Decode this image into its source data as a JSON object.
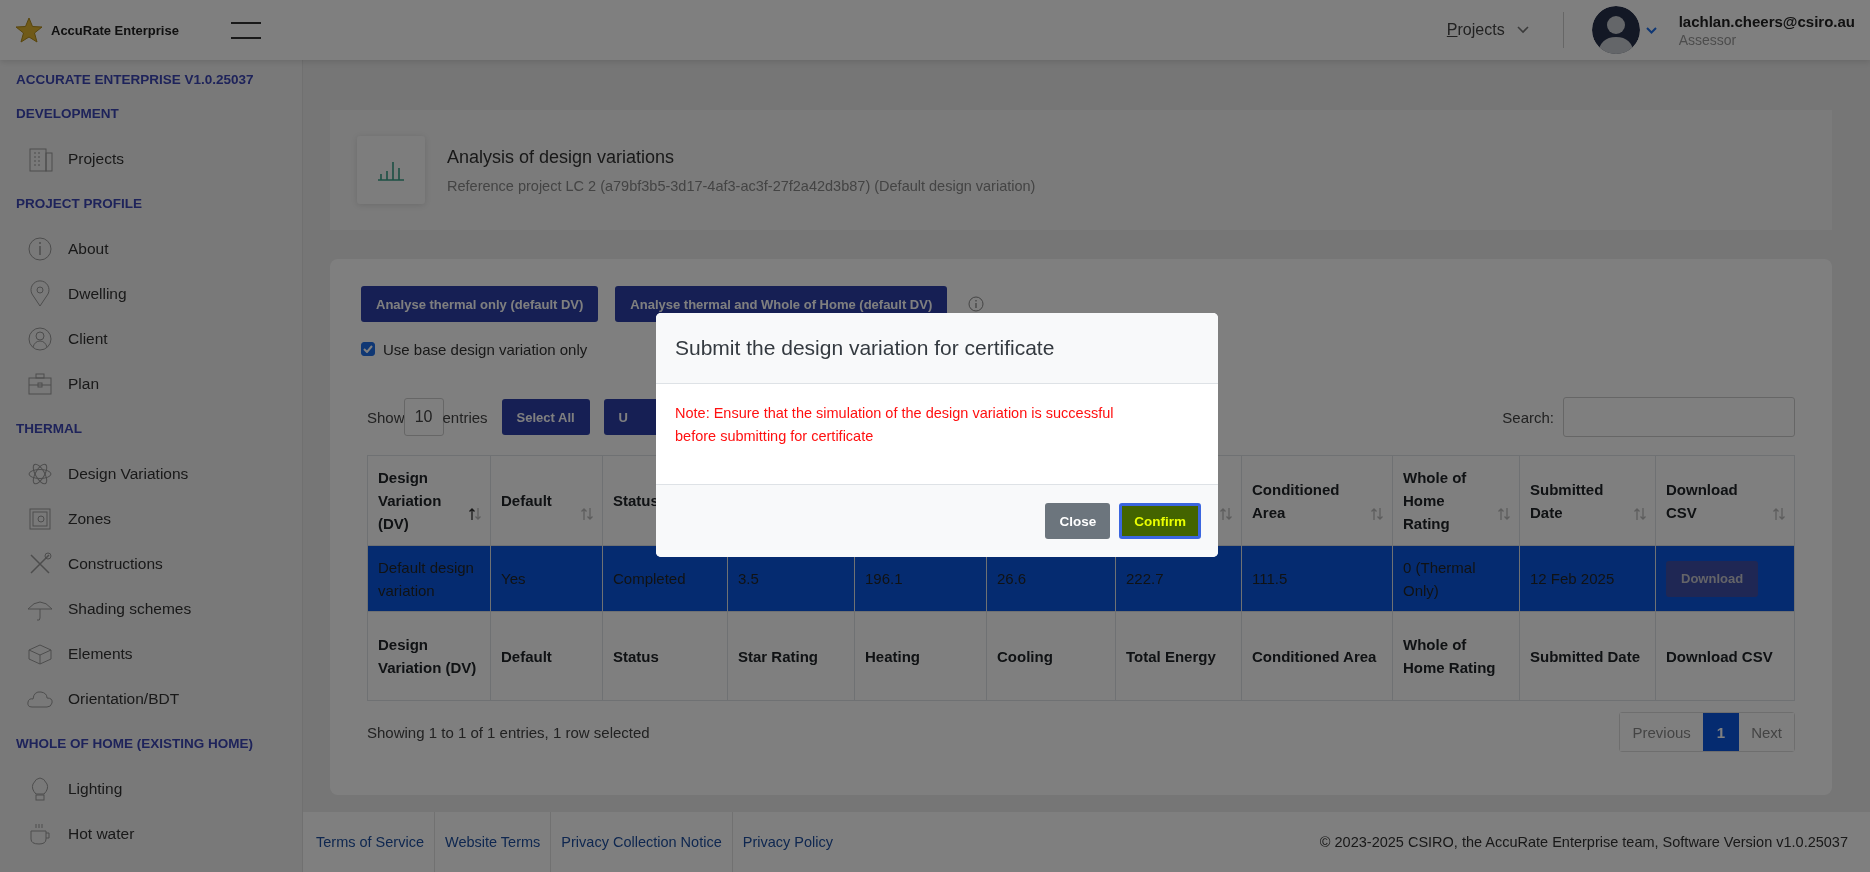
{
  "app": {
    "name": "AccuRate Enterprise"
  },
  "topbar": {
    "nav_menu": "Projects",
    "user": {
      "email": "lachlan.cheers@csiro.au",
      "role": "Assessor"
    }
  },
  "sidebar": {
    "sections": [
      {
        "heading": "ACCURATE ENTERPRISE V1.0.25037"
      },
      {
        "heading": "DEVELOPMENT",
        "items": [
          {
            "label": "Projects"
          }
        ]
      },
      {
        "heading": "PROJECT PROFILE",
        "items": [
          {
            "label": "About"
          },
          {
            "label": "Dwelling"
          },
          {
            "label": "Client"
          },
          {
            "label": "Plan"
          }
        ]
      },
      {
        "heading": "THERMAL",
        "items": [
          {
            "label": "Design Variations"
          },
          {
            "label": "Zones"
          },
          {
            "label": "Constructions"
          },
          {
            "label": "Shading schemes"
          },
          {
            "label": "Elements"
          },
          {
            "label": "Orientation/BDT"
          }
        ]
      },
      {
        "heading": "WHOLE OF HOME (EXISTING HOME)",
        "items": [
          {
            "label": "Lighting"
          },
          {
            "label": "Hot water"
          }
        ]
      }
    ]
  },
  "page_header": {
    "title": "Analysis of design variations",
    "subtitle": "Reference project LC 2 (a79bf3b5-3d17-4af3-ac3f-27f2a42d3b87) (Default design variation)"
  },
  "actions": [
    {
      "label": "Analyse thermal only (default DV)"
    },
    {
      "label": "Analyse thermal and Whole of Home (default DV)"
    }
  ],
  "base_only_checkbox": {
    "label": "Use base design variation only",
    "checked": true
  },
  "table_controls": {
    "show_label": "Show",
    "page_size": "10",
    "entries_label": "entries",
    "buttons": [
      "Select All",
      "U"
    ],
    "search_label": "Search:"
  },
  "table": {
    "columns": [
      {
        "label": "Design Variation (DV)",
        "sorted": true
      },
      {
        "label": "Default",
        "sorted": false
      },
      {
        "label": "Status"
      },
      {},
      {},
      {},
      {
        "sorted": false
      },
      {
        "label": "Conditioned Area",
        "sorted": false
      },
      {
        "label": "Whole of Home Rating",
        "sorted": false
      },
      {
        "label": "Submitted Date",
        "sorted": false
      },
      {
        "label": "Download CSV",
        "sorted": false
      }
    ],
    "rows": [
      {
        "selected": true,
        "cells": [
          "Default design variation",
          "Yes",
          "Completed",
          "3.5",
          "196.1",
          "26.6",
          "222.7",
          "111.5",
          "0 (Thermal Only)",
          "12 Feb 2025"
        ],
        "action": "Download"
      }
    ],
    "footer_columns": [
      "Design Variation (DV)",
      "Default",
      "Status",
      "Star Rating",
      "Heating",
      "Cooling",
      "Total Energy",
      "Conditioned Area",
      "Whole of Home Rating",
      "Submitted Date",
      "Download CSV"
    ]
  },
  "table_info": "Showing 1 to 1 of 1 entries, 1 row selected",
  "pagination": [
    {
      "label": "Previous",
      "selected": false
    },
    {
      "label": "1",
      "selected": true
    },
    {
      "label": "Next",
      "selected": false
    }
  ],
  "footer": {
    "links": [
      "Terms of Service",
      "Website Terms",
      "Privacy Collection Notice",
      "Privacy Policy"
    ],
    "copyright": "© 2023-2025 CSIRO, the AccuRate Enterprise team, Software Version v1.0.25037"
  },
  "modal": {
    "title": "Submit the design variation for certificate",
    "note": "Note: Ensure that the simulation of the design variation is successful before submitting for certificate",
    "buttons": [
      {
        "label": "Close",
        "kind": "secondary",
        "highlighted": false
      },
      {
        "label": "Confirm",
        "kind": "primary",
        "highlighted": true
      }
    ]
  }
}
